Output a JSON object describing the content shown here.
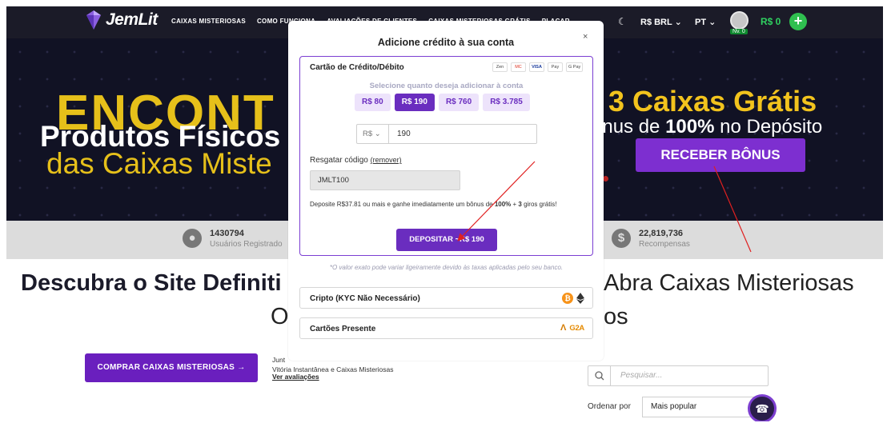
{
  "nav": {
    "brand": "JemLit",
    "links": [
      "CAIXAS MISTERIOSAS",
      "COMO FUNCIONA",
      "AVALIAÇÕES DE CLIENTES",
      "CAIXAS MISTERIOSAS GRÁTIS",
      "PLACAR"
    ],
    "currency": "R$ BRL",
    "language": "PT",
    "level": "Nv. 0",
    "balance": "R$ 0"
  },
  "hero": {
    "big": "ENCONT",
    "line1": "Produtos Físicos",
    "line2": "das Caixas Miste",
    "right1": "3 Caixas Grátis",
    "right2_pre": "ônus de ",
    "right2_bold": "100%",
    "right2_post": " no Depósito",
    "bonus_button": "RECEBER BÔNUS"
  },
  "stats": {
    "users_value": "1430794",
    "users_label": "Usuários Registrado",
    "rewards_value": "22,819,736",
    "rewards_label": "Recompensas"
  },
  "page": {
    "title_left": "Descubra o Site Definiti",
    "title_right": "Abra Caixas Misteriosas",
    "title2_left": "O",
    "title2_right": "os",
    "cta_button": "COMPRAR CAIXAS MISTERIOSAS →",
    "review_line1": "Junt",
    "review_line2": "Vitória Instantânea e Caixas Misteriosas",
    "review_link": "Ver avaliações",
    "search_placeholder": "Pesquisar...",
    "sort_label": "Ordenar por",
    "sort_value": "Mais popular"
  },
  "modal": {
    "title": "Adicione crédito à sua conta",
    "close": "×",
    "card_title": "Cartão de Crédito/Débito",
    "pay_logos": [
      "Zen",
      "MC",
      "VISA",
      "Pay",
      "G Pay"
    ],
    "select_label": "Selecione quanto deseja adicionar à conta",
    "amounts": [
      "R$ 80",
      "R$ 190",
      "R$ 760",
      "R$ 3.785"
    ],
    "selected_amount_index": 1,
    "currency_prefix": "R$",
    "amount_value": "190",
    "code_label": "Resgatar código",
    "code_remove": "(remover)",
    "code_value": "JMLT100",
    "info_pre": "Deposite R$37.81 ou mais e ganhe imediatamente um bônus de ",
    "info_b1": "100%",
    "info_mid": " + ",
    "info_b2": "3",
    "info_post": " giros grátis!",
    "deposit_button": "DEPOSITAR ~R$ 190",
    "disclaimer": "*O valor exato pode variar ligeiramente devido às taxas aplicadas pelo seu banco.",
    "crypto_label": "Cripto (KYC Não Necessário)",
    "gift_label": "Cartões Presente",
    "gift_brand": "G2A"
  },
  "colors": {
    "accent": "#6a2dbf",
    "annotation": "#e02020",
    "balance": "#2fd160"
  }
}
